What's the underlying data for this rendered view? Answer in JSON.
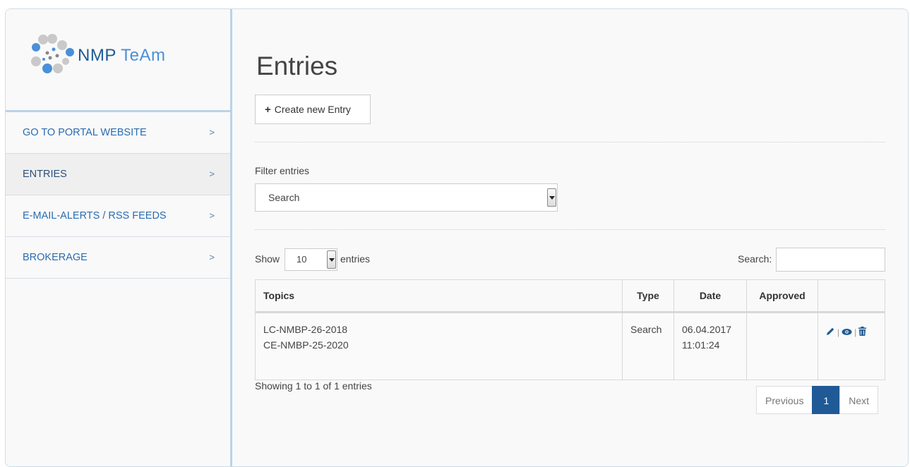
{
  "brand": {
    "logo_text_1": "NMP",
    "logo_text_2": "TeAm"
  },
  "sidebar": {
    "items": [
      {
        "label": "GO TO PORTAL WEBSITE"
      },
      {
        "label": "ENTRIES"
      },
      {
        "label": "E-MAIL-ALERTS / RSS FEEDS"
      },
      {
        "label": "BROKERAGE"
      }
    ],
    "chevron": ">"
  },
  "main": {
    "title": "Entries",
    "create_label": "Create new Entry",
    "filter_label": "Filter entries",
    "filter_value": "Search",
    "show_prefix": "Show",
    "page_length": "10",
    "show_suffix": "entries",
    "search_label": "Search:"
  },
  "table": {
    "columns": [
      "Topics",
      "Type",
      "Date",
      "Approved",
      ""
    ],
    "rows": [
      {
        "topic_1": "LC-NMBP-26-2018",
        "topic_2": "CE-NMBP-25-2020",
        "type": "Search",
        "date": "06.04.2017",
        "time": "11:01:24",
        "approved": ""
      }
    ],
    "info": "Showing 1 to 1 of 1 entries"
  },
  "pager": {
    "prev": "Previous",
    "current": "1",
    "next": "Next"
  },
  "colors": {
    "accent": "#1f5a96",
    "link": "#2a6cb0",
    "border": "#b9d3ea"
  }
}
